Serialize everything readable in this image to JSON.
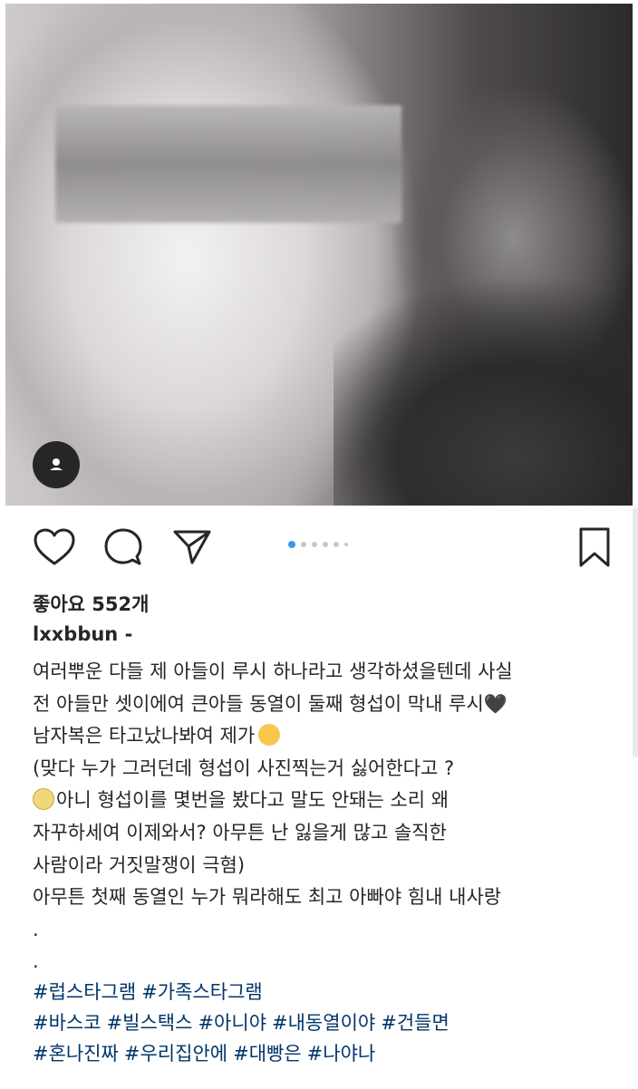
{
  "post": {
    "likes_label": "좋아요 552개",
    "username": "lxxbbun",
    "username_suffix": " -",
    "caption_lines": [
      "여러뿌운 다들 제 아들이 루시 하나라고 생각하셨을텐데 사실",
      "전 아들만 셋이에여 큰아들 동열이 둘째 형섭이 막내 루시",
      "남자복은 타고났나봐여 제가",
      "(맞다 누가 그러던데 형섭이 사진찍는거 싫어한다고 ?",
      "아니 형섭이를 몇번을 봤다고 말도 안돼는 소리 왜",
      "자꾸하세여 이제와서? 아무튼 난 잃을게 많고 솔직한",
      "사람이라 거짓말쟁이 극혐)",
      "아무튼 첫째 동열인 누가 뭐라해도 최고 아빠야 힘내 내사랑",
      ".",
      "."
    ],
    "heart_emoji": "🖤",
    "hashtag_rows": [
      [
        "#럽스타그램",
        "#가족스타그램"
      ],
      [
        "#바스코",
        "#빌스택스",
        "#아니야",
        "#내동열이야",
        "#건들면"
      ],
      [
        "#혼나진짜",
        "#우리집안에",
        "#대빵은",
        "#나야나"
      ]
    ]
  },
  "icons": {
    "like": "heart-outline-icon",
    "comment": "comment-bubble-icon",
    "share": "paper-plane-icon",
    "save": "bookmark-icon",
    "tag": "user-tag-icon"
  },
  "carousel": {
    "count": 6,
    "active_index": 0
  },
  "colors": {
    "accent": "#3897f0",
    "hashtag": "#003569",
    "text": "#262626"
  }
}
